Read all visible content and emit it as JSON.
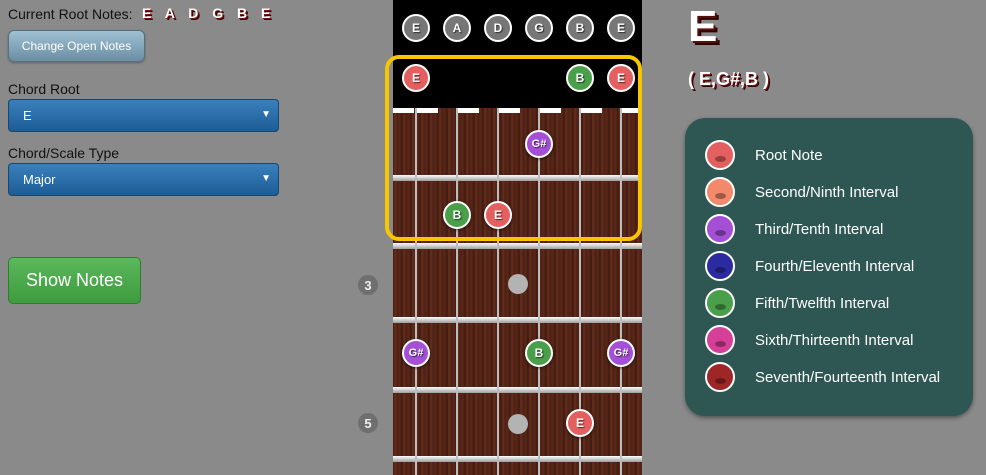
{
  "left_panel": {
    "root_notes_label": "Current Root Notes:",
    "root_notes_value": "E A D G B E",
    "change_button": "Change Open Notes",
    "chord_root_label": "Chord Root",
    "chord_root_value": "E",
    "chord_type_label": "Chord/Scale Type",
    "chord_type_value": "Major",
    "show_notes_button": "Show Notes"
  },
  "fretboard": {
    "open_strings": [
      "E",
      "A",
      "D",
      "G",
      "B",
      "E"
    ],
    "fret_markers": [
      "3",
      "5"
    ],
    "colors": {
      "root": "#e46060",
      "third": "#a44fd6",
      "fifth": "#4aa04a",
      "highlight": "#f7c600"
    },
    "notes": [
      {
        "fret": 0,
        "string": 1,
        "label": "E",
        "interval": "root"
      },
      {
        "fret": 0,
        "string": 5,
        "label": "B",
        "interval": "fifth"
      },
      {
        "fret": 0,
        "string": 6,
        "label": "E",
        "interval": "root"
      },
      {
        "fret": 1,
        "string": 4,
        "label": "G#",
        "interval": "third"
      },
      {
        "fret": 2,
        "string": 2,
        "label": "B",
        "interval": "fifth"
      },
      {
        "fret": 2,
        "string": 3,
        "label": "E",
        "interval": "root"
      },
      {
        "fret": 4,
        "string": 1,
        "label": "G#",
        "interval": "third"
      },
      {
        "fret": 4,
        "string": 4,
        "label": "B",
        "interval": "fifth"
      },
      {
        "fret": 4,
        "string": 6,
        "label": "G#",
        "interval": "third"
      },
      {
        "fret": 5,
        "string": 5,
        "label": "E",
        "interval": "root"
      }
    ]
  },
  "chord": {
    "name": "E",
    "notes": "( E,G#,B )"
  },
  "legend": [
    {
      "label": "Root Note",
      "color": "#e46060"
    },
    {
      "label": "Second/Ninth Interval",
      "color": "#f2896a"
    },
    {
      "label": "Third/Tenth Interval",
      "color": "#a44fd6"
    },
    {
      "label": "Fourth/Eleventh Interval",
      "color": "#2c2aa0"
    },
    {
      "label": "Fifth/Twelfth Interval",
      "color": "#4aa04a"
    },
    {
      "label": "Sixth/Thirteenth Interval",
      "color": "#d63f98"
    },
    {
      "label": "Seventh/Fourteenth Interval",
      "color": "#9e2626"
    }
  ]
}
